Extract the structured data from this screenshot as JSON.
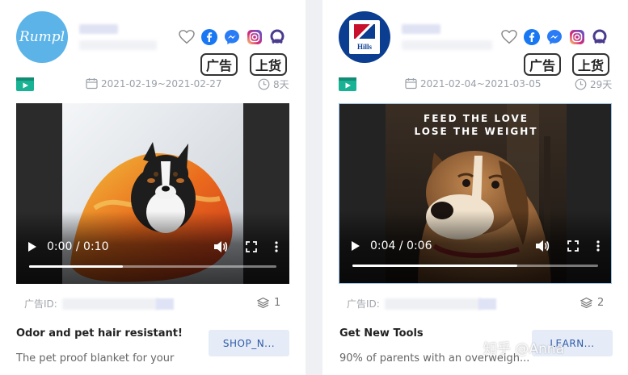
{
  "cards": [
    {
      "brand_logo_text": "Rumpl",
      "tags": [
        "广告",
        "上货"
      ],
      "date_range": "2021-02-19~2021-02-27",
      "duration": "8天",
      "video": {
        "time": "0:00 / 0:10",
        "progress": 0.38
      },
      "ad_id_label": "广告ID:",
      "creative_count": "1",
      "headline": "Odor and pet hair resistant!",
      "body": "The pet proof blanket for your",
      "cta": "SHOP_N..."
    },
    {
      "brand_logo_text": "Hills",
      "tags": [
        "广告",
        "上货"
      ],
      "date_range": "2021-02-04~2021-03-05",
      "duration": "29天",
      "video": {
        "time": "0:04 / 0:06",
        "progress": 0.67,
        "caption_line1": "FEED THE LOVE",
        "caption_line2": "LOSE THE WEIGHT"
      },
      "ad_id_label": "广告ID:",
      "creative_count": "2",
      "headline": "Get New Tools",
      "body": "90% of parents with an overweigh...",
      "cta": "LEARN..."
    }
  ],
  "watermark": "知乎 @Anna",
  "colors": {
    "facebook": "#1877f2",
    "messenger": "#2a7cf6",
    "instagram": "#d6249f",
    "accent_purple": "#4b3b8f",
    "video_badge": "#18b394"
  }
}
